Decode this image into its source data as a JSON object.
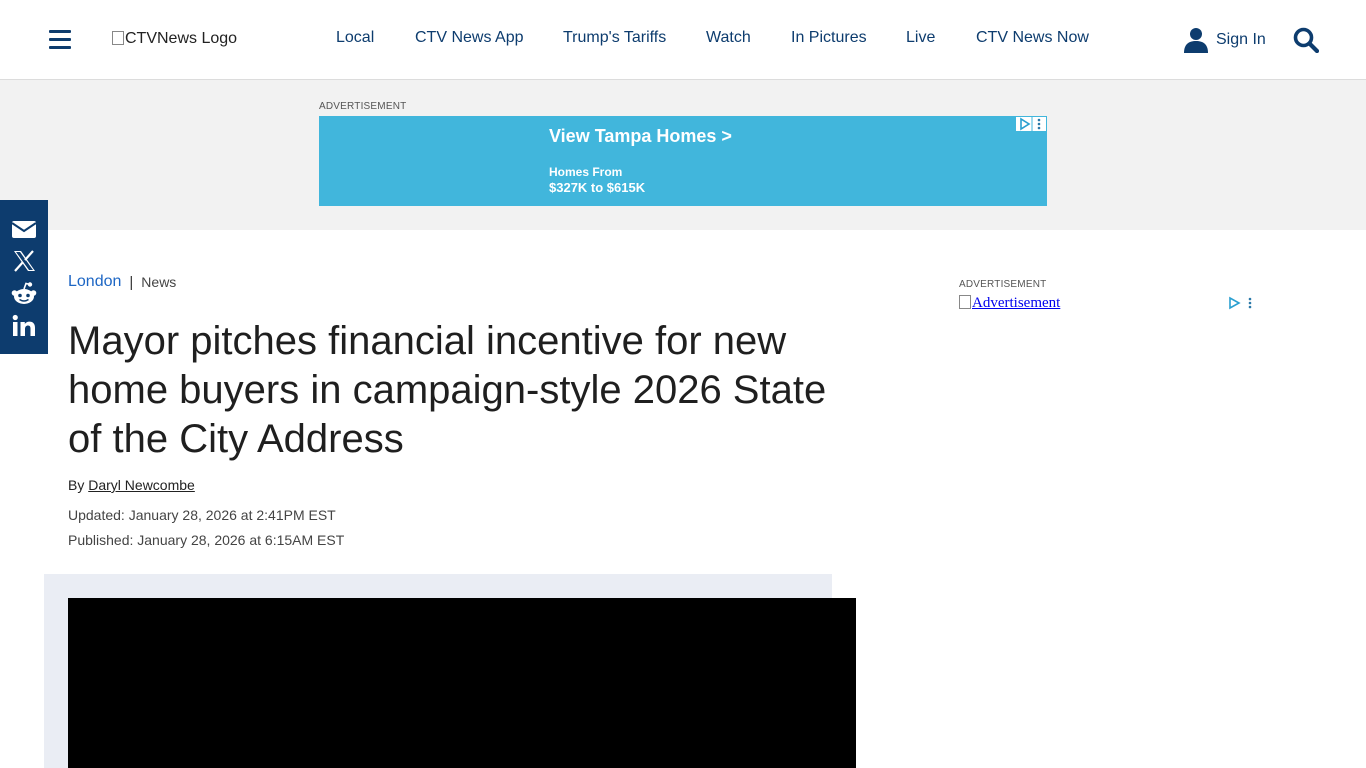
{
  "header": {
    "logo_alt": "CTVNews Logo",
    "nav": [
      {
        "label": "Local"
      },
      {
        "label": "CTV News App"
      },
      {
        "label": "Trump's Tariffs"
      },
      {
        "label": "Watch"
      },
      {
        "label": "In Pictures"
      },
      {
        "label": "Live"
      },
      {
        "label": "CTV News Now"
      }
    ],
    "sign_in": "Sign In"
  },
  "top_ad": {
    "label": "ADVERTISEMENT",
    "headline": "View Tampa Homes >",
    "line1": "Homes From",
    "line2": "$327K to $615K"
  },
  "social": {
    "icons": [
      "email-icon",
      "x-icon",
      "reddit-icon",
      "linkedin-icon"
    ]
  },
  "article": {
    "breadcrumb_primary": "London",
    "breadcrumb_separator": "|",
    "breadcrumb_secondary": "News",
    "title": "Mayor pitches financial incentive for new home buyers in campaign-style 2026 State of the City Address",
    "byline_prefix": "By",
    "author": "Daryl Newcombe",
    "updated": "Updated: January 28, 2026 at 2:41PM EST",
    "published": "Published: January 28, 2026 at 6:15AM EST"
  },
  "side_ad": {
    "label": "ADVERTISEMENT",
    "img_alt": "Advertisement"
  },
  "colors": {
    "brand_navy": "#0d3c6e",
    "link_blue": "#1d66c4",
    "ad_blue": "#41b6dc"
  }
}
